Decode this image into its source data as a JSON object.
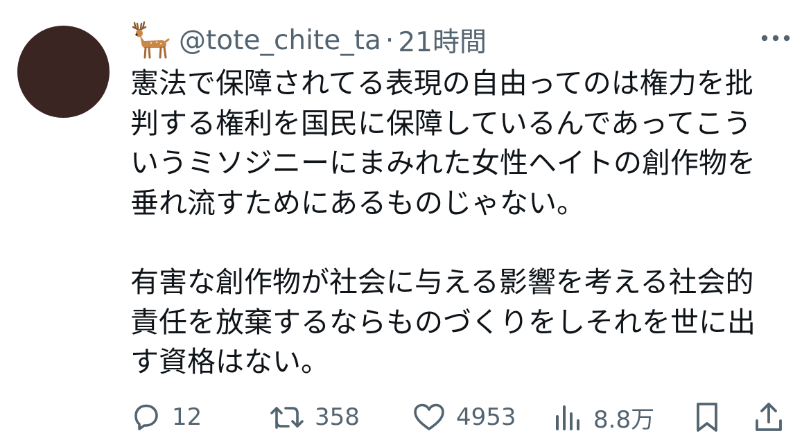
{
  "author": {
    "emoji_icon": "deer-icon",
    "handle": "@tote_chite_ta",
    "separator": "·",
    "timestamp": "21時間"
  },
  "tweet": {
    "paragraph1": [
      "憲法で保障されてる表現の自由ってのは権力を批",
      "判する権利を国民に保障しているんであってこう",
      "いうミソジニーにまみれた女性ヘイトの創作物を",
      "垂れ流すためにあるものじゃない。"
    ],
    "paragraph2": [
      "有害な創作物が社会に与える影響を考える社会的",
      "責任を放棄するならものづくりをしそれを世に出",
      "す資格はない。"
    ]
  },
  "actions": {
    "reply_count": "12",
    "retweet_count": "358",
    "like_count": "4953",
    "view_count": "8.8万"
  },
  "colors": {
    "text": "#0f1419",
    "muted": "#536471",
    "avatar": "#3a2523"
  }
}
